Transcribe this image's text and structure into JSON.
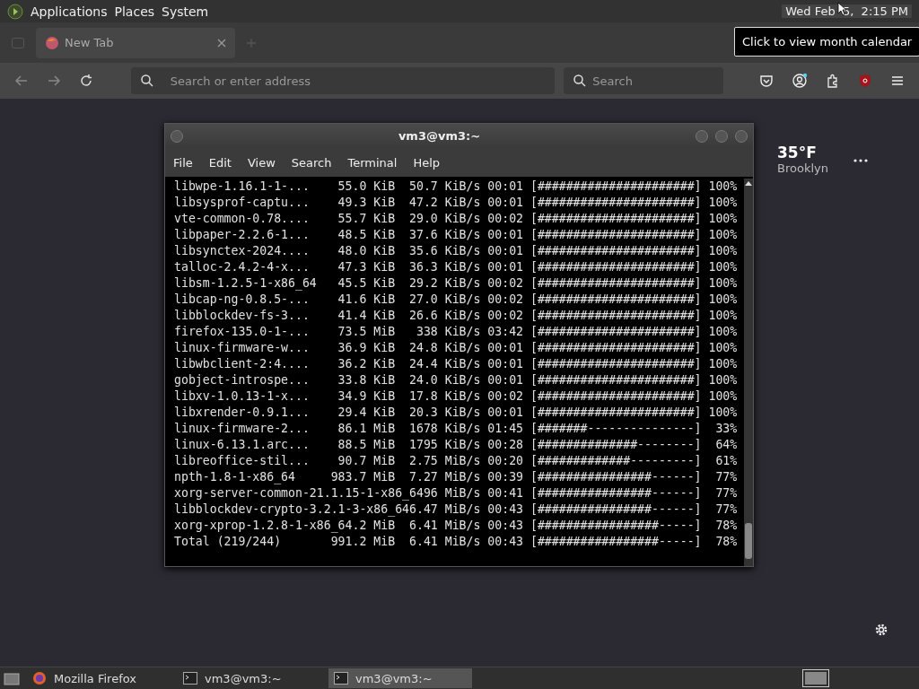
{
  "top_panel": {
    "menus": [
      "Applications",
      "Places",
      "System"
    ],
    "clock": "Wed Feb  5,  2:15 PM",
    "tooltip": "Click to view month calendar"
  },
  "browser": {
    "tabs": [
      {
        "label": "New Tab",
        "selected": true
      }
    ],
    "address_placeholder": "Search or enter address",
    "search_placeholder": "Search"
  },
  "terminal": {
    "title": "vm3@vm3:~",
    "menu": [
      "File",
      "Edit",
      "View",
      "Search",
      "Terminal",
      "Help"
    ],
    "lines": [
      "libwpe-1.16.1-1-...    55.0 KiB  50.7 KiB/s 00:01 [######################] 100%",
      "libsysprof-captu...    49.3 KiB  47.2 KiB/s 00:01 [######################] 100%",
      "vte-common-0.78....    55.7 KiB  29.0 KiB/s 00:02 [######################] 100%",
      "libpaper-2.2.6-1...    48.5 KiB  37.6 KiB/s 00:01 [######################] 100%",
      "libsynctex-2024....    48.0 KiB  35.6 KiB/s 00:01 [######################] 100%",
      "talloc-2.4.2-4-x...    47.3 KiB  36.3 KiB/s 00:01 [######################] 100%",
      "libsm-1.2.5-1-x86_64   45.5 KiB  29.2 KiB/s 00:02 [######################] 100%",
      "libcap-ng-0.8.5-...    41.6 KiB  27.0 KiB/s 00:02 [######################] 100%",
      "libblockdev-fs-3...    41.4 KiB  26.6 KiB/s 00:02 [######################] 100%",
      "firefox-135.0-1-...    73.5 MiB   338 KiB/s 03:42 [######################] 100%",
      "linux-firmware-w...    36.9 KiB  24.8 KiB/s 00:01 [######################] 100%",
      "libwbclient-2:4....    36.2 KiB  24.4 KiB/s 00:01 [######################] 100%",
      "gobject-introspe...    33.8 KiB  24.0 KiB/s 00:01 [######################] 100%",
      "libxv-1.0.13-1-x...    34.9 KiB  17.8 KiB/s 00:02 [######################] 100%",
      "libxrender-0.9.1...    29.4 KiB  20.3 KiB/s 00:01 [######################] 100%",
      "linux-firmware-2...    86.1 MiB  1678 KiB/s 01:45 [#######---------------]  33%",
      "linux-6.13.1.arc...    88.5 MiB  1795 KiB/s 00:28 [##############--------]  64%",
      "libreoffice-stil...    90.7 MiB  2.75 MiB/s 00:20 [#############---------]  61%",
      "npth-1.8-1-x86_64     983.7 MiB  7.27 MiB/s 00:39 [################------]  77%",
      "xorg-server-common-21.1.15-1-x86_6496 MiB/s 00:41 [################------]  77%",
      "libblockdev-crypto-3.2.1-3-x86_646.47 MiB/s 00:43 [################------]  77%",
      "xorg-xprop-1.2.8-1-x86_64.2 MiB  6.41 MiB/s 00:43 [#################-----]  78%",
      "Total (219/244)       991.2 MiB  6.41 MiB/s 00:43 [#################-----]  78%"
    ]
  },
  "weather": {
    "temperature": "35°F",
    "location": "Brooklyn"
  },
  "taskbar": {
    "items": [
      {
        "label": "Mozilla Firefox",
        "kind": "browser",
        "selected": false
      },
      {
        "label": "vm3@vm3:~",
        "kind": "terminal",
        "selected": false
      },
      {
        "label": "vm3@vm3:~",
        "kind": "terminal",
        "selected": true
      }
    ]
  }
}
